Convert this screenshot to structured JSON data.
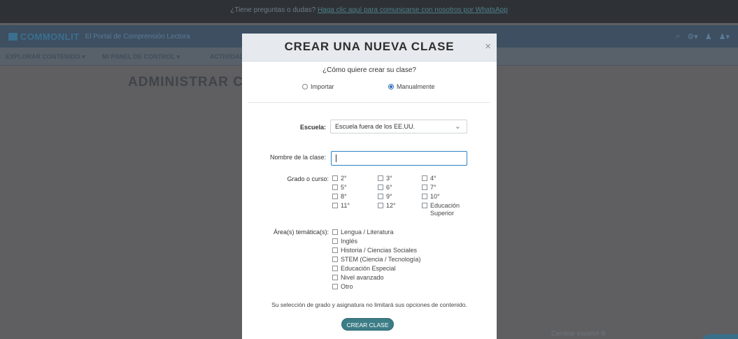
{
  "background": {
    "topbar": {
      "text": "¿Tiene preguntas o dudas? ",
      "link": "Haga clic aquí para comunicarse con nosotros por WhatsApp"
    },
    "brand": {
      "name": "COMMONLIT",
      "subtitle": "El Portal de Comprensión Lectora"
    },
    "menu": [
      "EXPLORAR CONTENIDO ▾",
      "MI PANEL DE CONTROL ▾",
      "ACTIVIDAD"
    ],
    "heading": "ADMINISTRAR C",
    "footer": "Cambiar español ⚙"
  },
  "modal": {
    "title": "CREAR UNA NUEVA CLASE",
    "close": "×",
    "question": "¿Cómo quiere crear su clase?",
    "radio_import": "Importar",
    "radio_manual": "Manualmente",
    "school_label": "Escuela:",
    "school_value": "Escuela fuera de los EE.UU.",
    "class_name_label": "Nombre de la clase:",
    "grade_label": "Grado o curso:",
    "grades": [
      "2°",
      "3°",
      "4°",
      "5°",
      "6°",
      "7°",
      "8°",
      "9°",
      "10°",
      "11°",
      "12°",
      "Educación Superior"
    ],
    "subject_label": "Área(s) temática(s):",
    "subjects": [
      "Lengua / Literatura",
      "Inglés",
      "Historia / Ciencias Sociales",
      "STEM (Ciencia / Tecnología)",
      "Educación Especial",
      "Nivel avanzado",
      "Otro"
    ],
    "note": "Su selección de grado y asignatura no limitará sus opciones de contenido.",
    "submit": "CREAR CLASE"
  }
}
